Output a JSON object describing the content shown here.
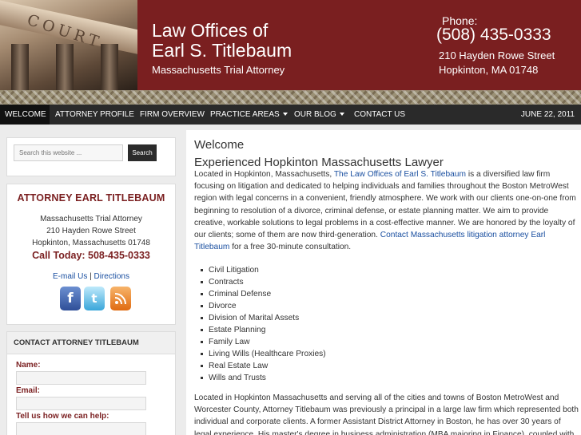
{
  "header": {
    "court_text": "COURT",
    "firm_name_line1": "Law Offices of",
    "firm_name_line2": "Earl S. Titlebaum",
    "tagline": "Massachusetts Trial Attorney",
    "phone_label": "Phone:",
    "phone_number": "(508) 435-0333",
    "street": "210 Hayden Rowe Street",
    "city": "Hopkinton, MA  01748"
  },
  "nav": {
    "items": [
      {
        "label": "WELCOME"
      },
      {
        "label": "ATTORNEY PROFILE"
      },
      {
        "label": "FIRM OVERVIEW"
      },
      {
        "label": "PRACTICE AREAS"
      },
      {
        "label": "OUR BLOG"
      },
      {
        "label": "CONTACT US"
      }
    ],
    "date": "JUNE 22, 2011"
  },
  "sidebar": {
    "search": {
      "placeholder": "Search this website ...",
      "button_label": "Search"
    },
    "attorney": {
      "title": "ATTORNEY EARL TITLEBAUM",
      "role": "Massachusetts Trial Attorney",
      "street": "210 Hayden Rowe Street",
      "city": "Hopkinton, Massachusetts 01748",
      "call_today": "Call Today: 508-435-0333",
      "email_link": "E-mail Us",
      "separator": "|",
      "directions_link": "Directions",
      "social_icons": [
        "facebook-icon",
        "twitter-icon",
        "rss-icon"
      ]
    },
    "contact_form": {
      "title": "CONTACT ATTORNEY TITLEBAUM",
      "name_label": "Name:",
      "email_label": "Email:",
      "message_label": "Tell us how we can help:"
    }
  },
  "main": {
    "welcome": "Welcome",
    "heading": "Experienced Hopkinton Massachusetts Lawyer",
    "intro_prefix": "Located in Hopkinton, Massachusetts,",
    "intro_link": "The Law Offices of Earl S. Titlebaum",
    "intro_body": "is a diversified law firm focusing on litigation and dedicated to helping individuals and families throughout the Boston MetroWest region with legal concerns in a convenient, friendly atmosphere. We work with our clients one-on-one from beginning to resolution of a divorce, criminal defense, or estate planning matter. We aim to provide creative, workable solutions to legal problems in a cost-effective manner. We are honored by the loyalty of our clients; some of them are now third-generation.",
    "intro_link2": "Contact Massachusetts litigation attorney Earl Titlebaum",
    "intro_suffix": "for a free 30-minute consultation.",
    "practice_areas": [
      "Civil Litigation",
      "Contracts",
      "Criminal Defense",
      "Divorce",
      "Division of Marital Assets",
      "Estate Planning",
      "Family Law",
      "Living Wills (Healthcare Proxies)",
      "Real Estate Law",
      "Wills and Trusts"
    ],
    "second_paragraph": "Located in Hopkinton Massachusetts and serving all of the cities and towns of Boston MetroWest and Worcester County, Attorney Titlebaum was previously a principal in a large law firm which represented both individual and corporate clients. A former Assistant District Attorney in Boston, he has over 30 years of legal experience. His master's degree in business administration (MBA majoring in Finance), coupled with his law"
  },
  "colors": {
    "brand": "#7a1f20",
    "nav_bg": "#2a2a2a",
    "link": "#1a4fa0"
  }
}
